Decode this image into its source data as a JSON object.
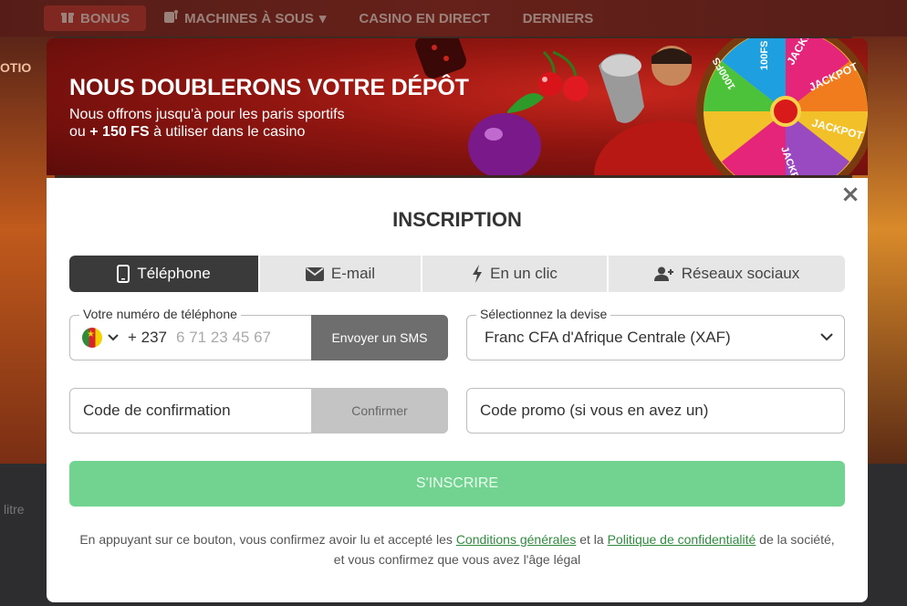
{
  "background": {
    "nav": [
      {
        "label": "BONUS",
        "icon": "gift-icon"
      },
      {
        "label": "MACHINES À SOUS",
        "icon": "slot-machine-icon"
      },
      {
        "label": "CASINO EN DIRECT",
        "icon": ""
      },
      {
        "label": "DERNIERS",
        "icon": ""
      }
    ],
    "side_left_text": "OTIO",
    "bottom_left_text": "litre"
  },
  "banner": {
    "headline": "NOUS DOUBLERONS VOTRE DÉPÔT",
    "line1": "Nous offrons jusqu'à pour les paris sportifs",
    "line2_prefix": "ou",
    "line2_bold": "+ 150 FS",
    "line2_suffix": "à utiliser dans le casino",
    "wheel_labels": [
      "JACKPOT",
      "JACKPOT",
      "JACKPOT",
      "100FS",
      "1000FS",
      "JACKPOT"
    ],
    "colors": {
      "primary": "#8f1510",
      "accent": "#c8261c"
    }
  },
  "modal": {
    "close_symbol": "×",
    "title": "INSCRIPTION",
    "tabs": [
      {
        "label": "Téléphone",
        "icon": "mobile-phone-icon",
        "active": true
      },
      {
        "label": "E-mail",
        "icon": "envelope-icon",
        "active": false
      },
      {
        "label": "En un clic",
        "icon": "lightning-icon",
        "active": false
      },
      {
        "label": "Réseaux sociaux",
        "icon": "users-icon",
        "active": false
      }
    ],
    "phone": {
      "label": "Votre numéro de téléphone",
      "country_flag": "cameroon-flag",
      "dial_code": "+ 237",
      "placeholder": "6 71 23 45 67",
      "sms_button": "Envoyer un SMS"
    },
    "currency": {
      "label": "Sélectionnez la devise",
      "value": "Franc CFA d'Afrique Centrale (XAF)"
    },
    "confirmation": {
      "placeholder": "Code de confirmation",
      "button": "Confirmer"
    },
    "promo": {
      "placeholder": "Code promo (si vous en avez un)"
    },
    "register_button": "S'INSCRIRE",
    "legal": {
      "part1": "En appuyant sur ce bouton, vous confirmez avoir lu et accepté les",
      "link1": "Conditions générales",
      "part2": "et la",
      "link2": "Politique de confidentialité",
      "part3": "de la société, et vous confirmez que vous avez l'âge légal"
    },
    "colors": {
      "tab_active": "#3a3a3a",
      "register": "#72d28f",
      "link": "#2e8b3e"
    }
  }
}
